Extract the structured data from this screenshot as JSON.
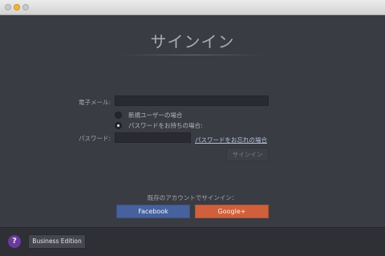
{
  "window": {
    "title": ""
  },
  "signin": {
    "title": "サインイン",
    "email_label": "電子メール:",
    "email_value": "",
    "new_user_label": "新規ユーザーの場合",
    "has_password_label": "パスワードをお持ちの場合:",
    "selected_option": "has_password",
    "password_label": "パスワード:",
    "password_value": "",
    "forgot_link": "パスワードをお忘れの場合",
    "signin_button": "サインイン"
  },
  "social": {
    "prompt": "既存のアカウントでサインイン：",
    "facebook_button": "Facebook",
    "google_button": "Google+"
  },
  "footer": {
    "help_icon": "?",
    "edition_button": "Business Edition"
  },
  "colors": {
    "facebook": "#46619d",
    "google": "#d0603b",
    "help": "#6b3a9e",
    "background": "#3a3c43"
  }
}
